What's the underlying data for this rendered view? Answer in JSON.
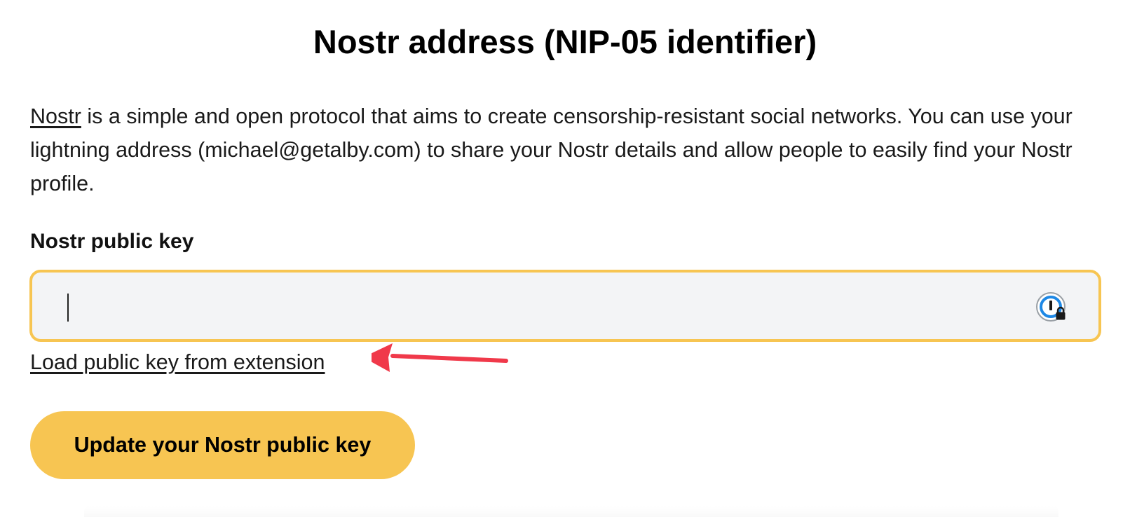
{
  "page": {
    "title": "Nostr address (NIP-05 identifier)"
  },
  "description": {
    "link_text": "Nostr",
    "text": " is a simple and open protocol that aims to create censorship-resistant social networks. You can use your lightning address (michael@getalby.com) to share your Nostr details and allow people to easily find your Nostr profile."
  },
  "form": {
    "field_label": "Nostr public key",
    "input_value": "",
    "password_manager_icon": "1password-lock-icon",
    "load_link": "Load public key from extension",
    "submit_label": "Update your Nostr public key"
  },
  "annotation": {
    "arrow_icon": "red-arrow-left-icon",
    "arrow_color": "#f0394a"
  },
  "colors": {
    "accent": "#f7c552",
    "input_bg": "#f3f4f6",
    "text": "#111111"
  }
}
